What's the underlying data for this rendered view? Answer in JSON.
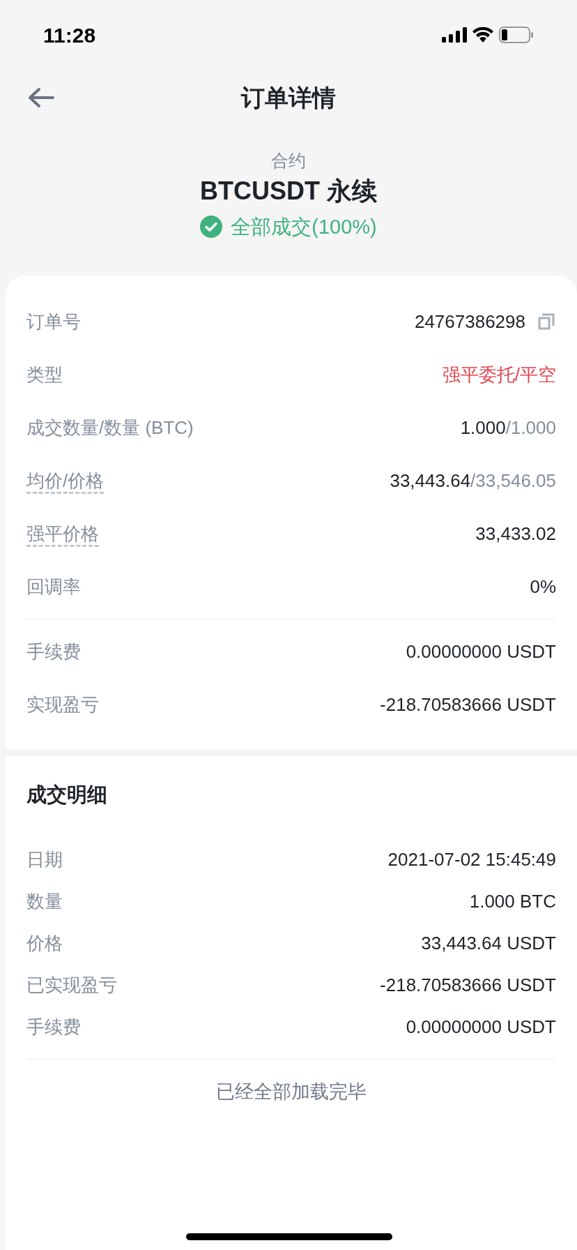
{
  "status_bar": {
    "time": "11:28"
  },
  "header": {
    "title": "订单详情"
  },
  "summary": {
    "category": "合约",
    "symbol": "BTCUSDT 永续",
    "status": "全部成交(100%)"
  },
  "order_rows": [
    {
      "label": "订单号",
      "value": "24767386298",
      "alert": false,
      "tooltip": false,
      "copyable": true
    },
    {
      "label": "类型",
      "value": "强平委托/平空",
      "alert": true,
      "tooltip": false,
      "copyable": false
    },
    {
      "label": "成交数量/数量 (BTC)",
      "value": "1.000",
      "secondary": "/1.000",
      "alert": false,
      "tooltip": false,
      "copyable": false
    },
    {
      "label": "均价/价格",
      "value": "33,443.64",
      "secondary": "/33,546.05",
      "alert": false,
      "tooltip": true,
      "copyable": false
    },
    {
      "label": "强平价格",
      "value": "33,433.02",
      "alert": false,
      "tooltip": true,
      "copyable": false
    },
    {
      "label": "回调率",
      "value": "0%",
      "alert": false,
      "tooltip": false,
      "copyable": false
    }
  ],
  "fee_rows": [
    {
      "label": "手续费",
      "value": "0.00000000 USDT"
    },
    {
      "label": "实现盈亏",
      "value": "-218.70583666 USDT"
    }
  ],
  "details": {
    "title": "成交明细",
    "rows": [
      {
        "label": "日期",
        "value": "2021-07-02 15:45:49"
      },
      {
        "label": "数量",
        "value": "1.000 BTC"
      },
      {
        "label": "价格",
        "value": "33,443.64 USDT"
      },
      {
        "label": "已实现盈亏",
        "value": "-218.70583666 USDT"
      },
      {
        "label": "手续费",
        "value": "0.00000000 USDT"
      }
    ]
  },
  "footer": "已经全部加载完毕"
}
